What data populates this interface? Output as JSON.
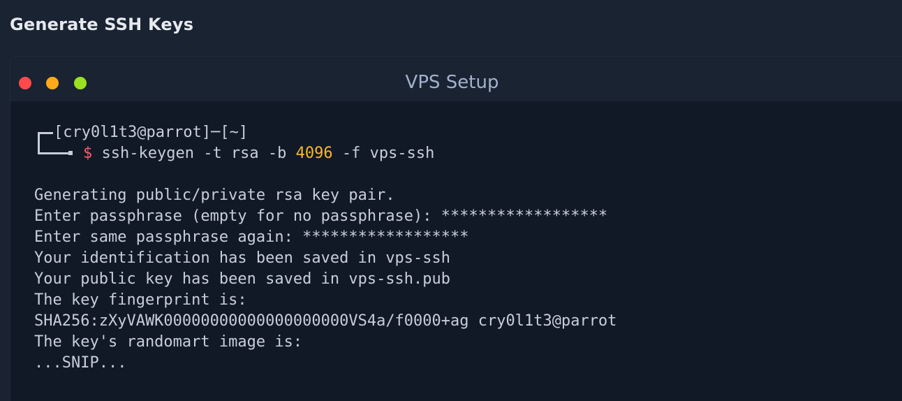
{
  "page": {
    "section_title": "Generate SSH Keys"
  },
  "window": {
    "title": "VPS Setup",
    "controls": {
      "close_color": "#ff4a4a",
      "minimize_color": "#ffaa1a",
      "maximize_color": "#9ae21f"
    }
  },
  "terminal": {
    "prompt_user": "[cry0l1t3@parrot]",
    "prompt_sep": "─",
    "prompt_dir": "[~]",
    "prompt_symbol": "$",
    "command_part1": "ssh-keygen -t rsa -b ",
    "command_number": "4096",
    "command_part2": " -f vps-ssh",
    "output_lines": [
      "Generating public/private rsa key pair.",
      "Enter passphrase (empty for no passphrase): ******************",
      "Enter same passphrase again: ******************",
      "Your identification has been saved in vps-ssh",
      "Your public key has been saved in vps-ssh.pub",
      "The key fingerprint is:",
      "SHA256:zXyVAWK00000000000000000000VS4a/f0000+ag cry0l1t3@parrot",
      "The key's randomart image is:",
      "...SNIP..."
    ]
  }
}
